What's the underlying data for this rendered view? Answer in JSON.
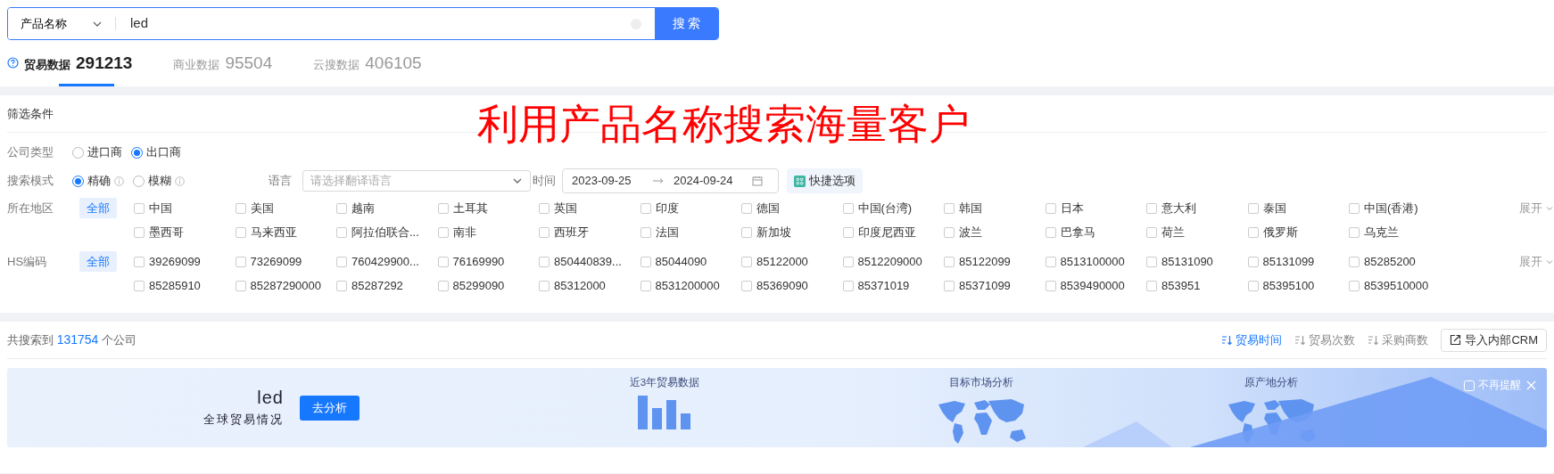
{
  "search": {
    "field_type": "产品名称",
    "query": "led",
    "button": "搜 索"
  },
  "data_tabs": [
    {
      "label": "贸易数据",
      "count": "291213",
      "selected": true
    },
    {
      "label": "商业数据",
      "count": "95504",
      "selected": false
    },
    {
      "label": "云搜数据",
      "count": "406105",
      "selected": false
    }
  ],
  "filter": {
    "title": "筛选条件",
    "annotation": "利用产品名称搜索海量客户",
    "company_type": {
      "label": "公司类型",
      "options": [
        {
          "label": "进口商",
          "selected": false,
          "info": false
        },
        {
          "label": "出口商",
          "selected": true,
          "info": false
        }
      ]
    },
    "search_mode": {
      "label": "搜索模式",
      "options": [
        {
          "label": "精确",
          "selected": true,
          "info": true
        },
        {
          "label": "模糊",
          "selected": false,
          "info": true
        }
      ]
    },
    "language": {
      "label": "语言",
      "placeholder": "请选择翻译语言"
    },
    "time": {
      "label": "时间",
      "start": "2023-09-25",
      "end": "2024-09-24"
    },
    "quick_button": "快捷选项",
    "groups": [
      {
        "label": "所在地区",
        "all_tag": "全部",
        "expand": "展开",
        "items": [
          {
            "label": "中国",
            "checked": false
          },
          {
            "label": "美国",
            "checked": false
          },
          {
            "label": "越南",
            "checked": false
          },
          {
            "label": "土耳其",
            "checked": false
          },
          {
            "label": "英国",
            "checked": false
          },
          {
            "label": "印度",
            "checked": false
          },
          {
            "label": "德国",
            "checked": false
          },
          {
            "label": "中国(台湾)",
            "checked": false
          },
          {
            "label": "韩国",
            "checked": false
          },
          {
            "label": "日本",
            "checked": false
          },
          {
            "label": "意大利",
            "checked": false
          },
          {
            "label": "泰国",
            "checked": false
          },
          {
            "label": "中国(香港)",
            "checked": false
          },
          {
            "label": "墨西哥",
            "checked": false
          },
          {
            "label": "马来西亚",
            "checked": false
          },
          {
            "label": "阿拉伯联合...",
            "checked": false
          },
          {
            "label": "南非",
            "checked": false
          },
          {
            "label": "西班牙",
            "checked": false
          },
          {
            "label": "法国",
            "checked": false
          },
          {
            "label": "新加坡",
            "checked": false
          },
          {
            "label": "印度尼西亚",
            "checked": false
          },
          {
            "label": "波兰",
            "checked": false
          },
          {
            "label": "巴拿马",
            "checked": false
          },
          {
            "label": "荷兰",
            "checked": false
          },
          {
            "label": "俄罗斯",
            "checked": false
          },
          {
            "label": "乌克兰",
            "checked": false
          }
        ]
      },
      {
        "label": "HS编码",
        "all_tag": "全部",
        "expand": "展开",
        "items": [
          {
            "label": "39269099",
            "checked": false
          },
          {
            "label": "73269099",
            "checked": false
          },
          {
            "label": "760429900...",
            "checked": false
          },
          {
            "label": "76169990",
            "checked": false
          },
          {
            "label": "850440839...",
            "checked": false
          },
          {
            "label": "85044090",
            "checked": false
          },
          {
            "label": "85122000",
            "checked": false
          },
          {
            "label": "8512209000",
            "checked": false
          },
          {
            "label": "85122099",
            "checked": false
          },
          {
            "label": "8513100000",
            "checked": false
          },
          {
            "label": "85131090",
            "checked": false
          },
          {
            "label": "85131099",
            "checked": false
          },
          {
            "label": "85285200",
            "checked": false
          },
          {
            "label": "85285910",
            "checked": false
          },
          {
            "label": "85287290000",
            "checked": false
          },
          {
            "label": "85287292",
            "checked": false
          },
          {
            "label": "85299090",
            "checked": false
          },
          {
            "label": "85312000",
            "checked": false
          },
          {
            "label": "8531200000",
            "checked": false
          },
          {
            "label": "85369090",
            "checked": false
          },
          {
            "label": "85371019",
            "checked": false
          },
          {
            "label": "85371099",
            "checked": false
          },
          {
            "label": "8539490000",
            "checked": false
          },
          {
            "label": "853951",
            "checked": false
          },
          {
            "label": "85395100",
            "checked": false
          },
          {
            "label": "8539510000",
            "checked": false
          }
        ]
      }
    ]
  },
  "results": {
    "prefix": "共搜索到",
    "count": "131754",
    "suffix": "个公司",
    "sort_options": [
      {
        "label": "贸易时间",
        "selected": true
      },
      {
        "label": "贸易次数",
        "selected": false
      },
      {
        "label": "采购商数",
        "selected": false
      }
    ],
    "import_button": "导入内部CRM"
  },
  "banner": {
    "keyword": "led",
    "subtitle": "全球贸易情况",
    "button": "去分析",
    "panels": [
      {
        "title": "近3年贸易数据",
        "kind": "bars"
      },
      {
        "title": "目标市场分析",
        "kind": "map"
      },
      {
        "title": "原产地分析",
        "kind": "map"
      }
    ],
    "dismiss": {
      "label": "不再提醒",
      "checked": false
    }
  }
}
